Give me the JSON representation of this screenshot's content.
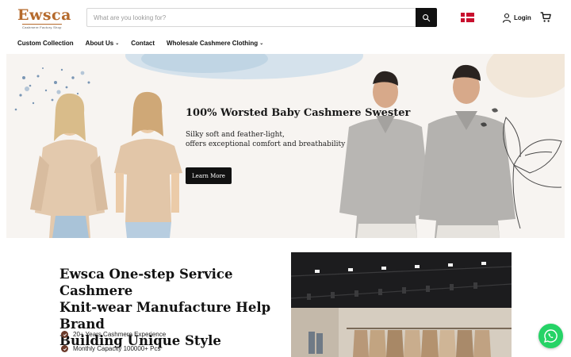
{
  "header": {
    "logo": {
      "word": "Ewsca",
      "tagline": "Cashmere Factory Shop"
    },
    "search": {
      "placeholder": "What are you looking for?",
      "value": ""
    },
    "login_label": "Login",
    "flag_icon": "denmark-flag-icon",
    "cart_icon": "cart-icon"
  },
  "nav": {
    "items": [
      {
        "label": "Custom Collection",
        "has_dropdown": false
      },
      {
        "label": "About Us",
        "has_dropdown": true
      },
      {
        "label": "Contact",
        "has_dropdown": false
      },
      {
        "label": "Wholesale Cashmere Clothing",
        "has_dropdown": true
      }
    ],
    "chevron": "⌄"
  },
  "hero": {
    "title": "100% Worsted Baby Cashmere Swester",
    "subtitle_line1": "Silky soft and feather-light,",
    "subtitle_line2": "offers exceptional comfort and  breathability",
    "button_label": "Learn More"
  },
  "intro": {
    "heading_line1": "Ewsca One-step Service Cashmere",
    "heading_line2": "Knit-wear Manufacture Help Brand",
    "heading_line3": "Building Unique Style",
    "features": [
      {
        "label": "20+ Years Cashmere Experience"
      },
      {
        "label": "Monthly Capacity 100000+ Pcs"
      }
    ]
  },
  "colors": {
    "brand": "#b56a2c",
    "check": "#6b3a2a",
    "whatsapp": "#25d366",
    "button": "#111111"
  }
}
